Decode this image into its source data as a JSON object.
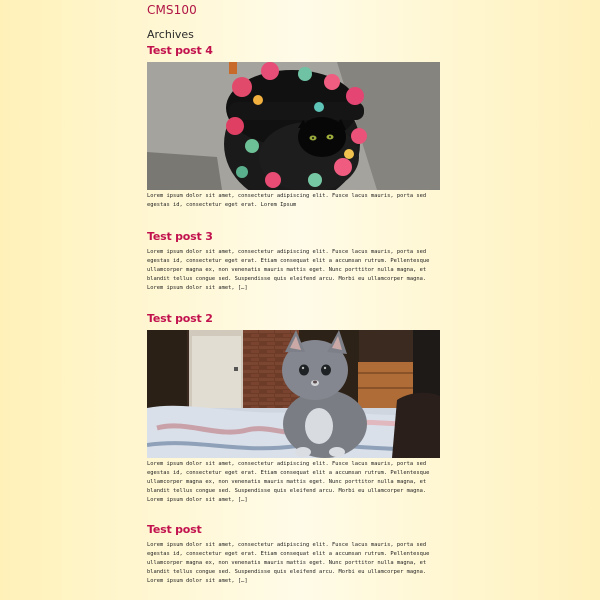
{
  "site": {
    "title": "CMS100"
  },
  "archive": {
    "heading": "Archives"
  },
  "posts": [
    {
      "title": "Test post 4",
      "image_subject": "black cat inside floral backpack",
      "excerpt": "Lorem ipsum dolor sit amet, consectetur adipiscing elit. Fusce lacus mauris, porta sed egestas id, consectetur eget erat. Lorem Ipsum"
    },
    {
      "title": "Test post 3",
      "excerpt": "Lorem ipsum dolor sit amet, consectetur adipiscing elit. Fusce lacus mauris, porta sed egestas id, consectetur eget erat. Etiam consequat elit a accumsan rutrum. Pellentesque ullamcorper magna ex, non venenatis mauris mattis eget. Nunc porttitor nulla magna, et blandit tellus congue sed. Suspendisse quis eleifend arcu. Morbi eu ullamcorper magna. Lorem ipsum dolor sit amet, […]"
    },
    {
      "title": "Test post 2",
      "image_subject": "grey kitten sitting on a bed",
      "excerpt": "Lorem ipsum dolor sit amet, consectetur adipiscing elit. Fusce lacus mauris, porta sed egestas id, consectetur eget erat. Etiam consequat elit a accumsan rutrum. Pellentesque ullamcorper magna ex, non venenatis mauris mattis eget. Nunc porttitor nulla magna, et blandit tellus congue sed. Suspendisse quis eleifend arcu. Morbi eu ullamcorper magna. Lorem ipsum dolor sit amet, […]"
    },
    {
      "title": "Test post",
      "excerpt": "Lorem ipsum dolor sit amet, consectetur adipiscing elit. Fusce lacus mauris, porta sed egestas id, consectetur eget erat. Etiam consequat elit a accumsan rutrum. Pellentesque ullamcorper magna ex, non venenatis mauris mattis eget. Nunc porttitor nulla magna, et blandit tellus congue sed. Suspendisse quis eleifend arcu. Morbi eu ullamcorper magna. Lorem ipsum dolor sit amet, […]"
    }
  ],
  "colors": {
    "brand": "#b01545",
    "post_title": "#c2124e",
    "text": "#222222",
    "background_edge": "#fff1b8",
    "background_center": "#fffbe8"
  }
}
